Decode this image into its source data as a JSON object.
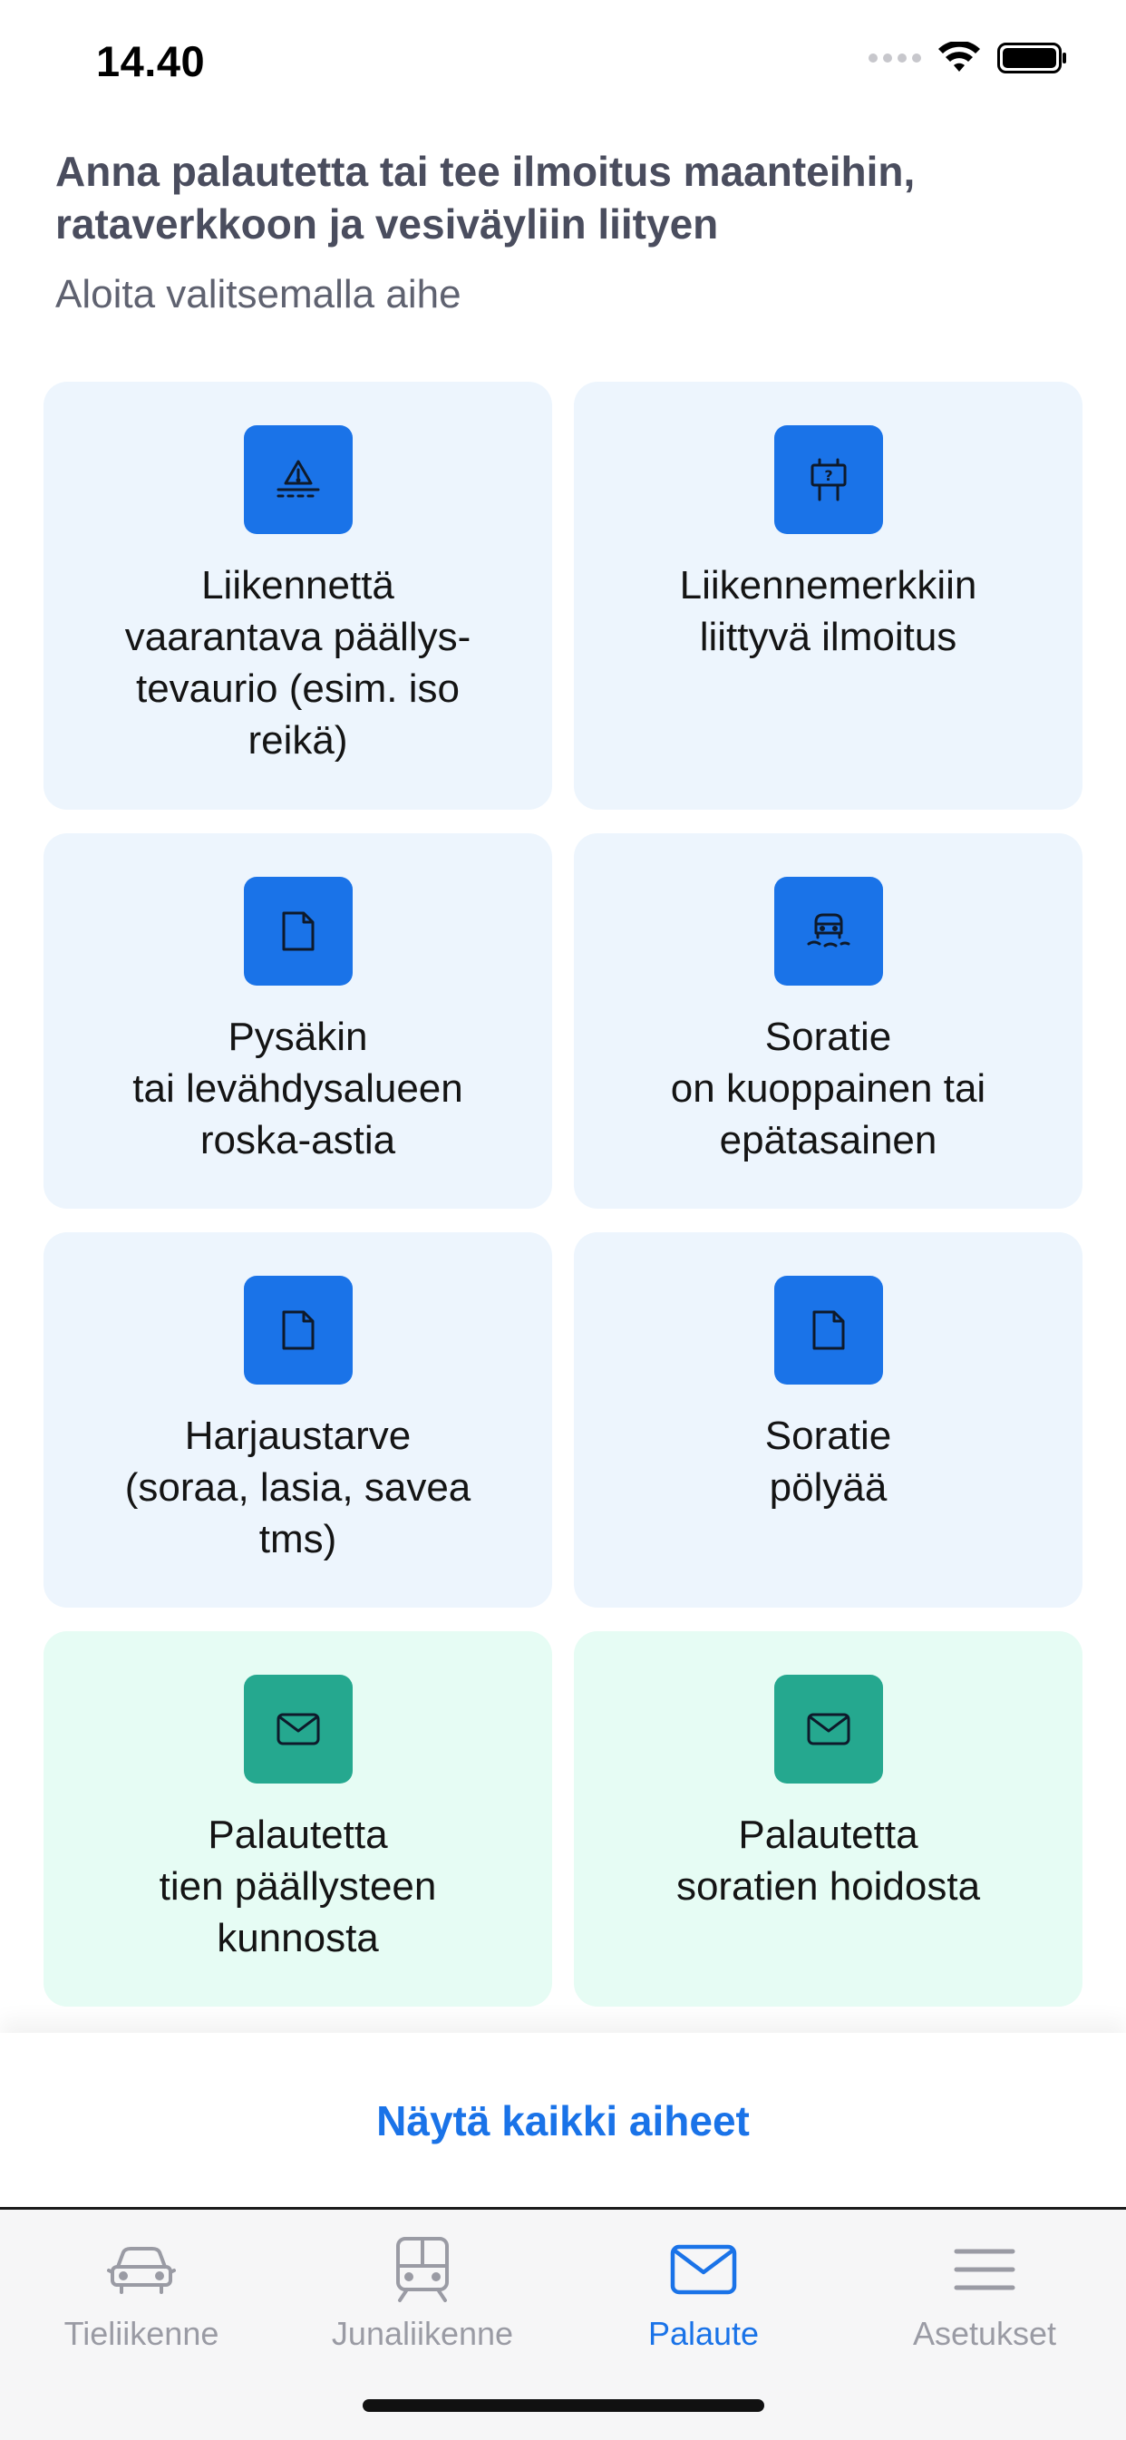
{
  "status_bar": {
    "time": "14.40"
  },
  "header": {
    "title": "Anna palautetta tai tee ilmoitus maanteihin, rataverkkoon ja vesiväyliin liityen",
    "subtitle": "Aloita valitsemalla aihe"
  },
  "cards": [
    {
      "label": "Liikennettä\nvaarantava päällys-\ntevaurio (esim. iso\nreikä)",
      "icon": "road-hazard-icon",
      "color": "#1a73e8"
    },
    {
      "label": "Liikennemerkkiin\nliittyvä ilmoitus",
      "icon": "traffic-sign-icon",
      "color": "#1a73e8"
    },
    {
      "label": "Pysäkin\ntai levähdysalueen\nroska-astia",
      "icon": "document-icon",
      "color": "#1a73e8"
    },
    {
      "label": "Soratie\non kuoppainen tai\nepätasainen",
      "icon": "car-bumpy-road-icon",
      "color": "#1a73e8"
    },
    {
      "label": "Harjaustarve\n(soraa, lasia, savea\ntms)",
      "icon": "document-icon",
      "color": "#1a73e8"
    },
    {
      "label": "Soratie\npölyää",
      "icon": "document-icon",
      "color": "#1a73e8"
    },
    {
      "label": "Palautetta\ntien päällysteen\nkunnosta",
      "icon": "envelope-icon",
      "color": "#25a88f"
    },
    {
      "label": "Palautetta\nsoratien hoidosta",
      "icon": "envelope-icon",
      "color": "#25a88f"
    }
  ],
  "show_all_label": "Näytä kaikki aiheet",
  "tabs": [
    {
      "label": "Tieliikenne",
      "icon": "car-icon",
      "active": false
    },
    {
      "label": "Junaliikenne",
      "icon": "train-icon",
      "active": false
    },
    {
      "label": "Palaute",
      "icon": "envelope-icon",
      "active": true
    },
    {
      "label": "Asetukset",
      "icon": "menu-icon",
      "active": false
    }
  ],
  "colors": {
    "accent": "#1a73e8",
    "green": "#25a88f",
    "card_blue_bg": "#edf5fd",
    "card_green_bg": "#e6fcf4"
  }
}
